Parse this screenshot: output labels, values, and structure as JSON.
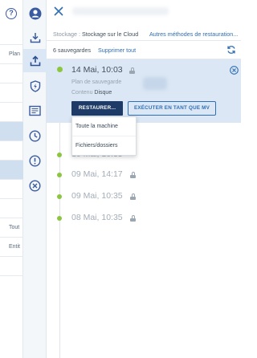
{
  "background": {
    "rows": [
      "",
      "Plan",
      "",
      "",
      "",
      "",
      "",
      "",
      "",
      "",
      "Tout",
      "Entit",
      ""
    ]
  },
  "strip": {
    "icons": [
      "user-circle-icon",
      "download-icon",
      "upload-icon",
      "shield-bolt-icon",
      "report-icon",
      "clock-icon",
      "alert-circle-icon",
      "x-circle-icon"
    ]
  },
  "panel": {
    "storage_label": "Stockage : ",
    "storage_value": "Stockage sur le Cloud",
    "other_methods": "Autres méthodes de restauration...",
    "backups_count": "6 sauvegardes",
    "delete_all": "Supprimer tout"
  },
  "selected_backup": {
    "date": "14 Mai, 10:03",
    "plan_label": "Plan de sauvegarde",
    "content_label": "Contenu ",
    "content_value": "Disque",
    "restore_button": "RESTAURER...",
    "run_vm_button": "EXÉCUTER EN TANT QUE MV"
  },
  "restore_menu": [
    "Toute la machine",
    "Fichiers/dossiers"
  ],
  "backups": [
    {
      "date": "10 Mai, 10:35"
    },
    {
      "date": "09 Mai, 14:17"
    },
    {
      "date": "09 Mai, 10:35"
    },
    {
      "date": "08 Mai, 10:35"
    }
  ],
  "colors": {
    "accent": "#2f6fb5",
    "primary_button": "#1d3b66",
    "selected_bg": "#dbe7f4",
    "status_dot": "#8cc63f"
  }
}
